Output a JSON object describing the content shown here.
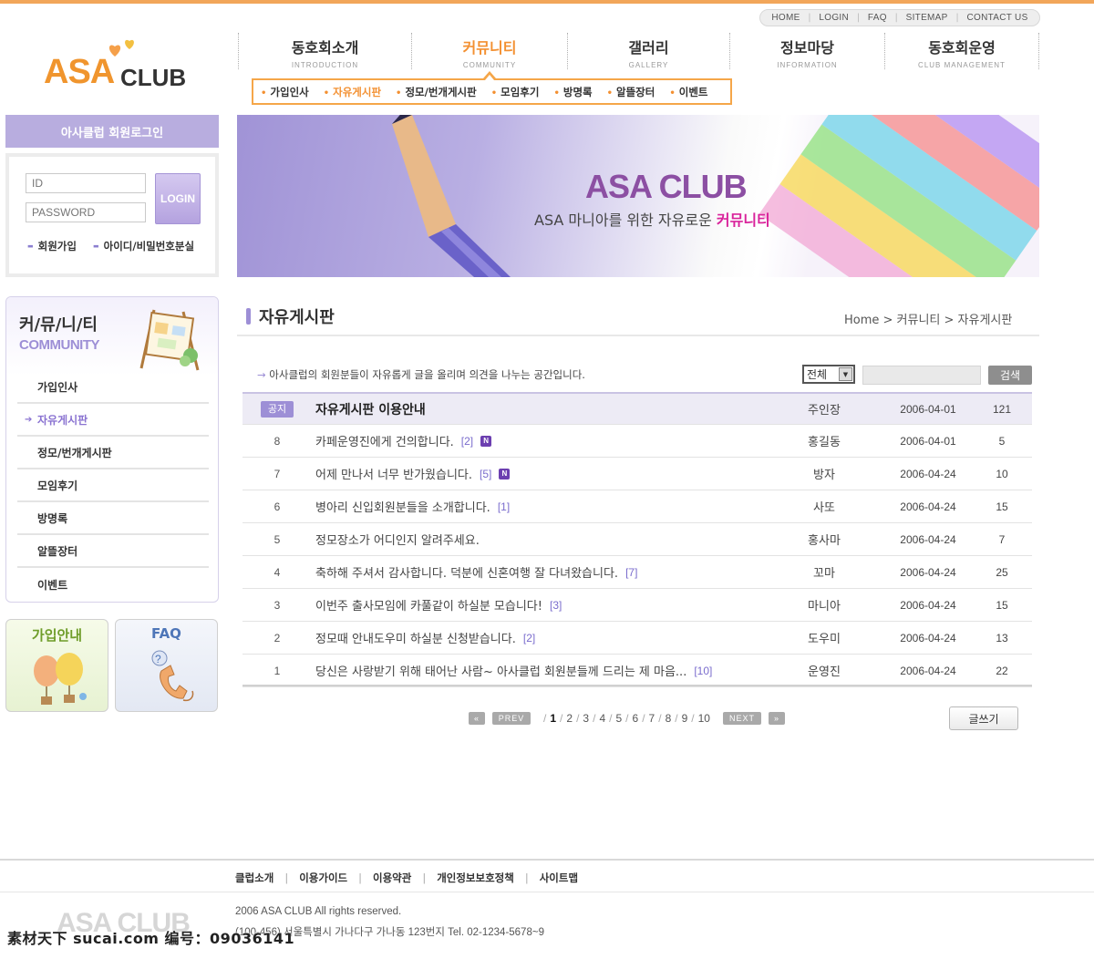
{
  "util_nav": [
    "HOME",
    "LOGIN",
    "FAQ",
    "SITEMAP",
    "CONTACT US"
  ],
  "logo": {
    "asa": "ASA",
    "club": "CLUB"
  },
  "main_nav": [
    {
      "kr": "동호회소개",
      "en": "INTRODUCTION"
    },
    {
      "kr": "커뮤니티",
      "en": "COMMUNITY"
    },
    {
      "kr": "갤러리",
      "en": "GALLERY"
    },
    {
      "kr": "정보마당",
      "en": "INFORMATION"
    },
    {
      "kr": "동호회운영",
      "en": "CLUB MANAGEMENT"
    }
  ],
  "sub_nav": [
    "가입인사",
    "자유게시판",
    "정모/번개게시판",
    "모임후기",
    "방명록",
    "알뜰장터",
    "이벤트"
  ],
  "login": {
    "title": "아사클럽 회원로그인",
    "id_placeholder": "ID",
    "pw_placeholder": "PASSWORD",
    "button": "LOGIN",
    "join": "회원가입",
    "find": "아이디/비밀번호분실"
  },
  "sidebar": {
    "title_kr": "커/뮤/니/티",
    "title_en": "COMMUNITY",
    "items": [
      "가입인사",
      "자유게시판",
      "정모/번개게시판",
      "모임후기",
      "방명록",
      "알뜰장터",
      "이벤트"
    ]
  },
  "banners": {
    "join": "가입안내",
    "faq": "FAQ"
  },
  "hero": {
    "title": "ASA CLUB",
    "sub_prefix": "ASA 마니아를 위한 자유로운 ",
    "sub_highlight": "커뮤니티"
  },
  "board": {
    "title": "자유게시판",
    "breadcrumb": "Home > 커뮤니티 > 자유게시판",
    "description": "아사클럽의 회원분들이 자유롭게 글을 올리며 의견을 나누는 공간입니다.",
    "search_select": "전체",
    "search_button": "검색",
    "notice": {
      "badge": "공지",
      "subject": "자유게시판 이용안내",
      "writer": "주인장",
      "date": "2006-04-01",
      "hits": "121"
    },
    "posts": [
      {
        "no": "8",
        "subject": "카페운영진에게 건의합니다.",
        "comments": "[2]",
        "new": "N",
        "writer": "홍길동",
        "date": "2006-04-01",
        "hits": "5"
      },
      {
        "no": "7",
        "subject": "어제 만나서 너무 반가웠습니다.",
        "comments": "[5]",
        "new": "N",
        "writer": "방자",
        "date": "2006-04-24",
        "hits": "10"
      },
      {
        "no": "6",
        "subject": "병아리 신입회원분들을 소개합니다.",
        "comments": "[1]",
        "new": "",
        "writer": "사또",
        "date": "2006-04-24",
        "hits": "15"
      },
      {
        "no": "5",
        "subject": "정모장소가 어디인지 알려주세요.",
        "comments": "",
        "new": "",
        "writer": "홍사마",
        "date": "2006-04-24",
        "hits": "7"
      },
      {
        "no": "4",
        "subject": "축하해 주셔서 감사합니다. 덕분에 신혼여행 잘 다녀왔습니다.",
        "comments": "[7]",
        "new": "",
        "writer": "꼬마",
        "date": "2006-04-24",
        "hits": "25"
      },
      {
        "no": "3",
        "subject": "이번주 출사모임에 카풀같이 하실분 모습니다!",
        "comments": "[3]",
        "new": "",
        "writer": "마니아",
        "date": "2006-04-24",
        "hits": "15"
      },
      {
        "no": "2",
        "subject": "정모때 안내도우미 하실분 신청받습니다.",
        "comments": "[2]",
        "new": "",
        "writer": "도우미",
        "date": "2006-04-24",
        "hits": "13"
      },
      {
        "no": "1",
        "subject": "당신은 사랑받기 위해 태어난 사람~ 아사클럽 회원분들께 드리는 제 마음...",
        "comments": "[10]",
        "new": "",
        "writer": "운영진",
        "date": "2006-04-24",
        "hits": "22"
      }
    ]
  },
  "pagination": {
    "prev": "PREV",
    "next": "NEXT",
    "pages": [
      "1",
      "2",
      "3",
      "4",
      "5",
      "6",
      "7",
      "8",
      "9",
      "10"
    ],
    "current": "1"
  },
  "write_button": "글쓰기",
  "footer": {
    "links": [
      "클럽소개",
      "이용가이드",
      "이용약관",
      "개인정보보호정책",
      "사이트맵"
    ],
    "logo": "ASA CLUB",
    "copyright": "2006 ASA CLUB All rights reserved.",
    "address": "(100-456) 서울특별시 가나다구 가나동 123번지 Tel. 02-1234-5678~9"
  },
  "watermark": "素材天下 sucai.com 编号：09036141",
  "colors": {
    "accent_orange": "#f39031",
    "accent_purple": "#9d8fd6",
    "new_badge": "#6c3fb0"
  }
}
